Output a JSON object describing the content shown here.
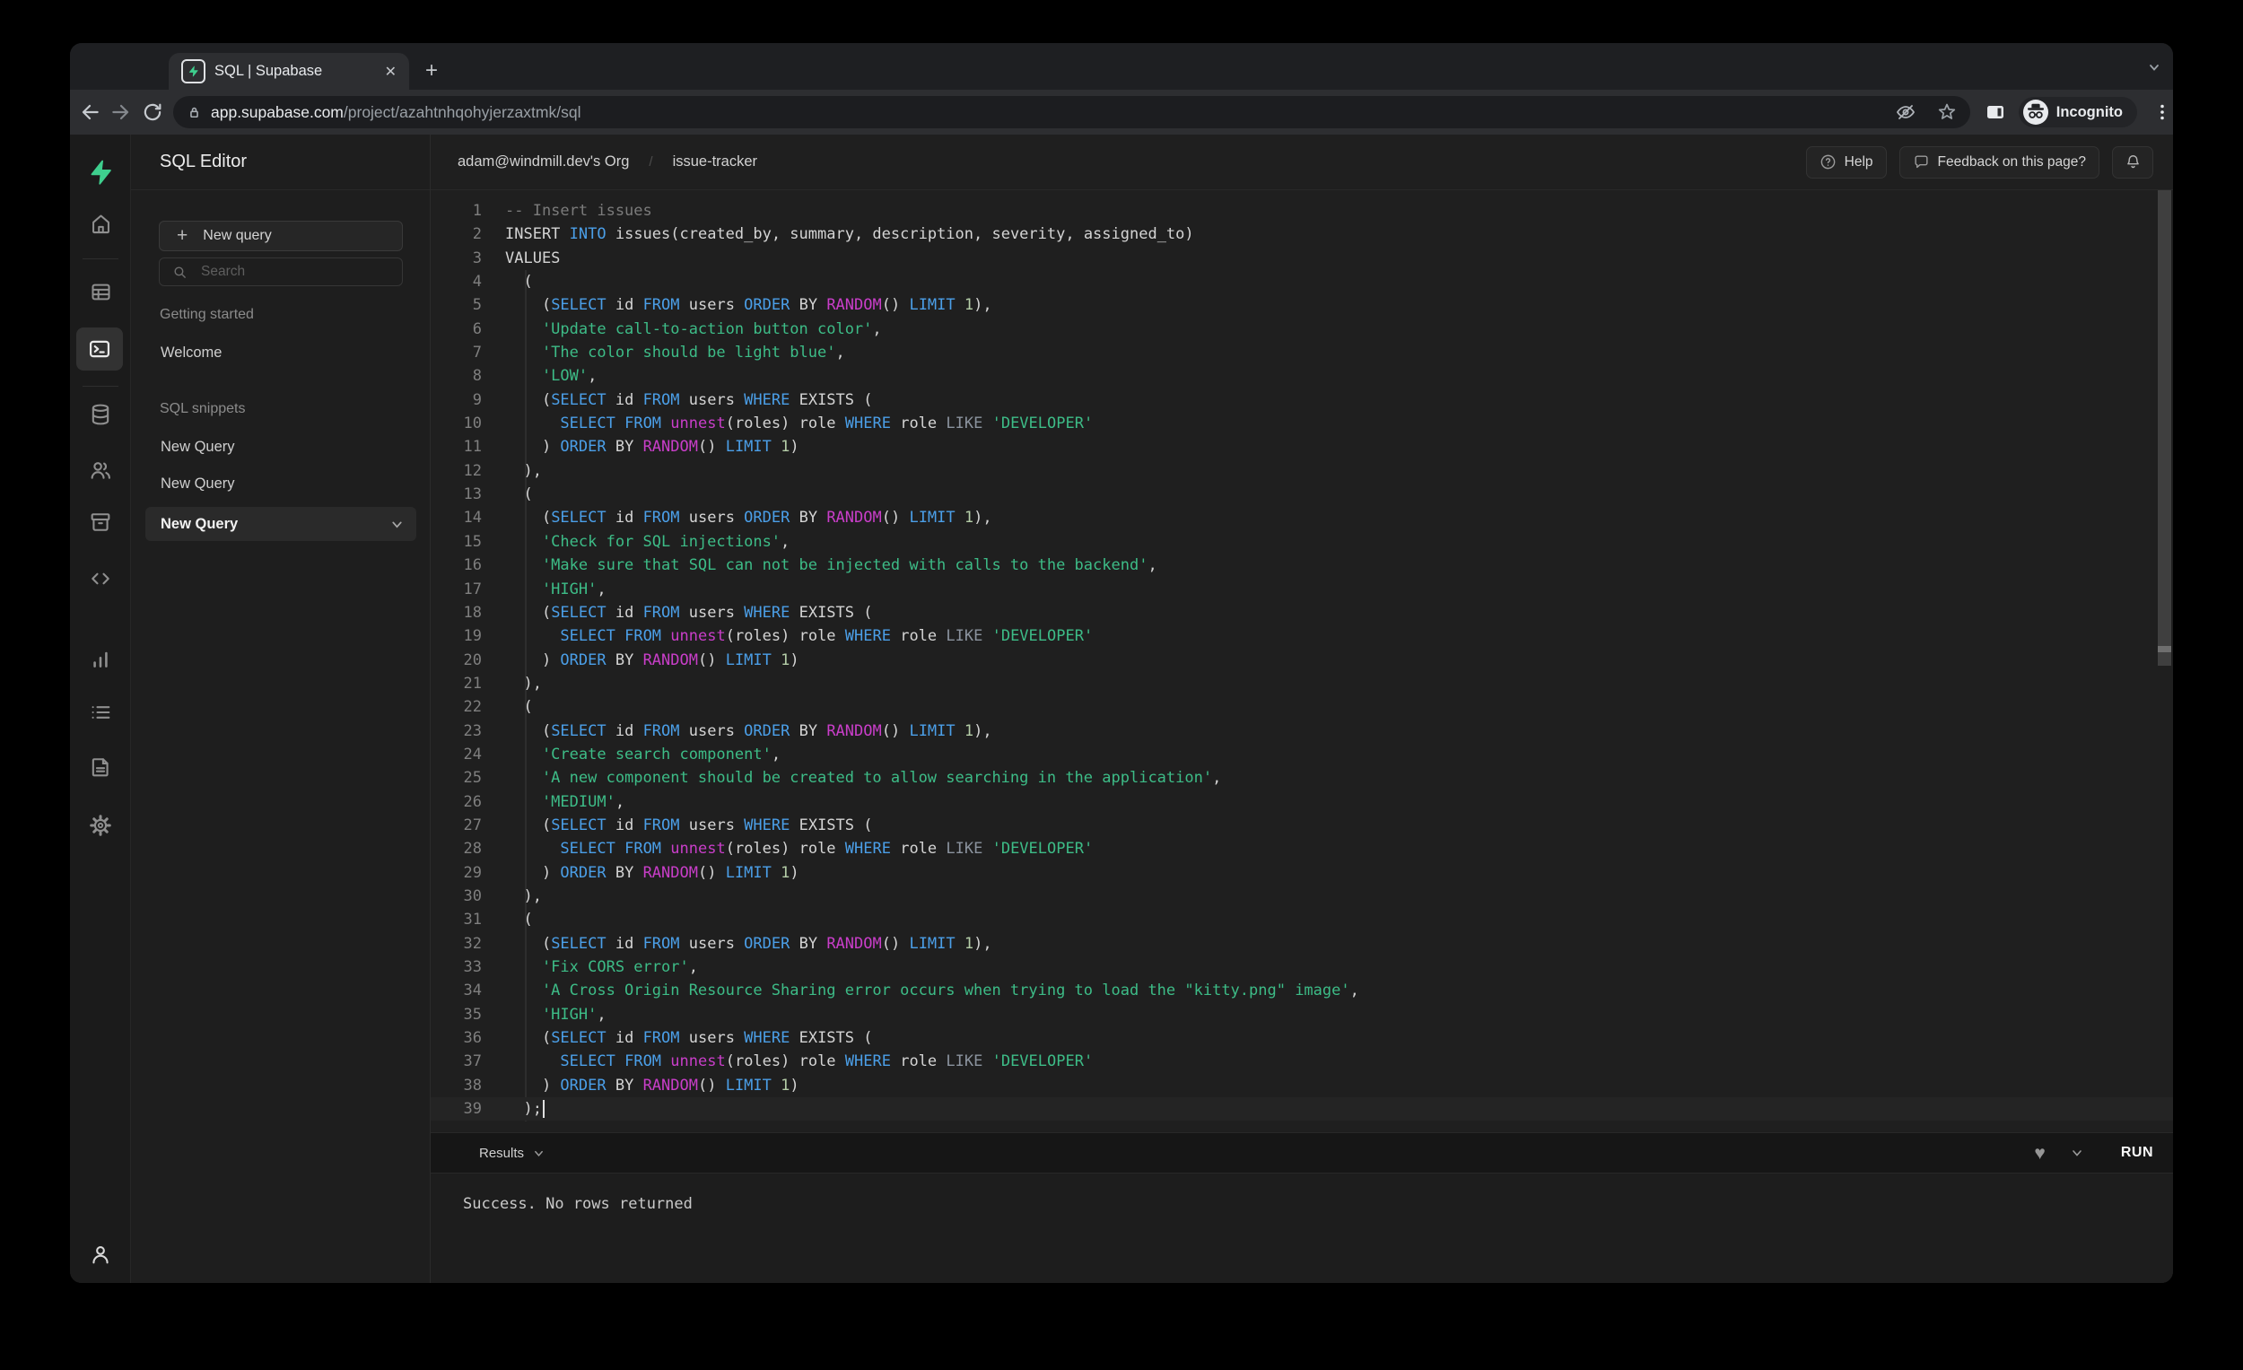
{
  "browser": {
    "tab_title": "SQL | Supabase",
    "url_host": "app.supabase.com",
    "url_path": "/project/azahtnhqohyjerzaxtmk/sql",
    "incognito_label": "Incognito"
  },
  "rail_icons": [
    "home",
    "table-editor",
    "sql-editor",
    "database",
    "auth",
    "storage",
    "api",
    "reports",
    "logs",
    "docs",
    "settings",
    "account"
  ],
  "panel": {
    "title": "SQL Editor",
    "new_query_label": "New query",
    "search_placeholder": "Search",
    "getting_started_label": "Getting started",
    "getting_started_items": [
      "Welcome"
    ],
    "snippets_label": "SQL snippets",
    "snippets": [
      "New Query",
      "New Query",
      "New Query"
    ],
    "selected_index": 2
  },
  "header": {
    "org": "adam@windmill.dev's Org",
    "separator": "/",
    "project": "issue-tracker",
    "help_label": "Help",
    "feedback_label": "Feedback on this page?"
  },
  "editor": {
    "language": "sql",
    "cursor_line": 39,
    "lines": [
      [
        [
          "c",
          "-- Insert issues"
        ]
      ],
      [
        [
          "w",
          "INSERT "
        ],
        [
          "b",
          "INTO"
        ],
        [
          "w",
          " issues(created_by, summary, description, severity, assigned_to)"
        ]
      ],
      [
        [
          "w",
          "VALUES"
        ]
      ],
      [
        [
          "w",
          "  ("
        ]
      ],
      [
        [
          "w",
          "    ("
        ],
        [
          "b",
          "SELECT"
        ],
        [
          "w",
          " id "
        ],
        [
          "b",
          "FROM"
        ],
        [
          "w",
          " users "
        ],
        [
          "b",
          "ORDER"
        ],
        [
          "w",
          " BY "
        ],
        [
          "m",
          "RANDOM"
        ],
        [
          "w",
          "() "
        ],
        [
          "b",
          "LIMIT"
        ],
        [
          "n",
          " 1"
        ],
        [
          "w",
          "),"
        ]
      ],
      [
        [
          "g",
          "    'Update call-to-action button color'"
        ],
        [
          "w",
          ","
        ]
      ],
      [
        [
          "g",
          "    'The color should be light blue'"
        ],
        [
          "w",
          ","
        ]
      ],
      [
        [
          "g",
          "    'LOW'"
        ],
        [
          "w",
          ","
        ]
      ],
      [
        [
          "w",
          "    ("
        ],
        [
          "b",
          "SELECT"
        ],
        [
          "w",
          " id "
        ],
        [
          "b",
          "FROM"
        ],
        [
          "w",
          " users "
        ],
        [
          "b",
          "WHERE"
        ],
        [
          "w",
          " EXISTS ("
        ]
      ],
      [
        [
          "w",
          "      "
        ],
        [
          "b",
          "SELECT"
        ],
        [
          "w",
          " "
        ],
        [
          "b",
          "FROM"
        ],
        [
          "w",
          " "
        ],
        [
          "m",
          "unnest"
        ],
        [
          "w",
          "(roles) role "
        ],
        [
          "b",
          "WHERE"
        ],
        [
          "w",
          " role "
        ],
        [
          "o",
          "LIKE"
        ],
        [
          "w",
          " "
        ],
        [
          "g",
          "'DEVELOPER'"
        ]
      ],
      [
        [
          "w",
          "    ) "
        ],
        [
          "b",
          "ORDER"
        ],
        [
          "w",
          " BY "
        ],
        [
          "m",
          "RANDOM"
        ],
        [
          "w",
          "() "
        ],
        [
          "b",
          "LIMIT"
        ],
        [
          "n",
          " 1"
        ],
        [
          "w",
          ")"
        ]
      ],
      [
        [
          "w",
          "  ),"
        ]
      ],
      [
        [
          "w",
          "  ("
        ]
      ],
      [
        [
          "w",
          "    ("
        ],
        [
          "b",
          "SELECT"
        ],
        [
          "w",
          " id "
        ],
        [
          "b",
          "FROM"
        ],
        [
          "w",
          " users "
        ],
        [
          "b",
          "ORDER"
        ],
        [
          "w",
          " BY "
        ],
        [
          "m",
          "RANDOM"
        ],
        [
          "w",
          "() "
        ],
        [
          "b",
          "LIMIT"
        ],
        [
          "n",
          " 1"
        ],
        [
          "w",
          "),"
        ]
      ],
      [
        [
          "g",
          "    'Check for SQL injections'"
        ],
        [
          "w",
          ","
        ]
      ],
      [
        [
          "g",
          "    'Make sure that SQL can not be injected with calls to the backend'"
        ],
        [
          "w",
          ","
        ]
      ],
      [
        [
          "g",
          "    'HIGH'"
        ],
        [
          "w",
          ","
        ]
      ],
      [
        [
          "w",
          "    ("
        ],
        [
          "b",
          "SELECT"
        ],
        [
          "w",
          " id "
        ],
        [
          "b",
          "FROM"
        ],
        [
          "w",
          " users "
        ],
        [
          "b",
          "WHERE"
        ],
        [
          "w",
          " EXISTS ("
        ]
      ],
      [
        [
          "w",
          "      "
        ],
        [
          "b",
          "SELECT"
        ],
        [
          "w",
          " "
        ],
        [
          "b",
          "FROM"
        ],
        [
          "w",
          " "
        ],
        [
          "m",
          "unnest"
        ],
        [
          "w",
          "(roles) role "
        ],
        [
          "b",
          "WHERE"
        ],
        [
          "w",
          " role "
        ],
        [
          "o",
          "LIKE"
        ],
        [
          "w",
          " "
        ],
        [
          "g",
          "'DEVELOPER'"
        ]
      ],
      [
        [
          "w",
          "    ) "
        ],
        [
          "b",
          "ORDER"
        ],
        [
          "w",
          " BY "
        ],
        [
          "m",
          "RANDOM"
        ],
        [
          "w",
          "() "
        ],
        [
          "b",
          "LIMIT"
        ],
        [
          "n",
          " 1"
        ],
        [
          "w",
          ")"
        ]
      ],
      [
        [
          "w",
          "  ),"
        ]
      ],
      [
        [
          "w",
          "  ("
        ]
      ],
      [
        [
          "w",
          "    ("
        ],
        [
          "b",
          "SELECT"
        ],
        [
          "w",
          " id "
        ],
        [
          "b",
          "FROM"
        ],
        [
          "w",
          " users "
        ],
        [
          "b",
          "ORDER"
        ],
        [
          "w",
          " BY "
        ],
        [
          "m",
          "RANDOM"
        ],
        [
          "w",
          "() "
        ],
        [
          "b",
          "LIMIT"
        ],
        [
          "n",
          " 1"
        ],
        [
          "w",
          "),"
        ]
      ],
      [
        [
          "g",
          "    'Create search component'"
        ],
        [
          "w",
          ","
        ]
      ],
      [
        [
          "g",
          "    'A new component should be created to allow searching in the application'"
        ],
        [
          "w",
          ","
        ]
      ],
      [
        [
          "g",
          "    'MEDIUM'"
        ],
        [
          "w",
          ","
        ]
      ],
      [
        [
          "w",
          "    ("
        ],
        [
          "b",
          "SELECT"
        ],
        [
          "w",
          " id "
        ],
        [
          "b",
          "FROM"
        ],
        [
          "w",
          " users "
        ],
        [
          "b",
          "WHERE"
        ],
        [
          "w",
          " EXISTS ("
        ]
      ],
      [
        [
          "w",
          "      "
        ],
        [
          "b",
          "SELECT"
        ],
        [
          "w",
          " "
        ],
        [
          "b",
          "FROM"
        ],
        [
          "w",
          " "
        ],
        [
          "m",
          "unnest"
        ],
        [
          "w",
          "(roles) role "
        ],
        [
          "b",
          "WHERE"
        ],
        [
          "w",
          " role "
        ],
        [
          "o",
          "LIKE"
        ],
        [
          "w",
          " "
        ],
        [
          "g",
          "'DEVELOPER'"
        ]
      ],
      [
        [
          "w",
          "    ) "
        ],
        [
          "b",
          "ORDER"
        ],
        [
          "w",
          " BY "
        ],
        [
          "m",
          "RANDOM"
        ],
        [
          "w",
          "() "
        ],
        [
          "b",
          "LIMIT"
        ],
        [
          "n",
          " 1"
        ],
        [
          "w",
          ")"
        ]
      ],
      [
        [
          "w",
          "  ),"
        ]
      ],
      [
        [
          "w",
          "  ("
        ]
      ],
      [
        [
          "w",
          "    ("
        ],
        [
          "b",
          "SELECT"
        ],
        [
          "w",
          " id "
        ],
        [
          "b",
          "FROM"
        ],
        [
          "w",
          " users "
        ],
        [
          "b",
          "ORDER"
        ],
        [
          "w",
          " BY "
        ],
        [
          "m",
          "RANDOM"
        ],
        [
          "w",
          "() "
        ],
        [
          "b",
          "LIMIT"
        ],
        [
          "n",
          " 1"
        ],
        [
          "w",
          "),"
        ]
      ],
      [
        [
          "g",
          "    'Fix CORS error'"
        ],
        [
          "w",
          ","
        ]
      ],
      [
        [
          "g",
          "    'A Cross Origin Resource Sharing error occurs when trying to load the \"kitty.png\" image'"
        ],
        [
          "w",
          ","
        ]
      ],
      [
        [
          "g",
          "    'HIGH'"
        ],
        [
          "w",
          ","
        ]
      ],
      [
        [
          "w",
          "    ("
        ],
        [
          "b",
          "SELECT"
        ],
        [
          "w",
          " id "
        ],
        [
          "b",
          "FROM"
        ],
        [
          "w",
          " users "
        ],
        [
          "b",
          "WHERE"
        ],
        [
          "w",
          " EXISTS ("
        ]
      ],
      [
        [
          "w",
          "      "
        ],
        [
          "b",
          "SELECT"
        ],
        [
          "w",
          " "
        ],
        [
          "b",
          "FROM"
        ],
        [
          "w",
          " "
        ],
        [
          "m",
          "unnest"
        ],
        [
          "w",
          "(roles) role "
        ],
        [
          "b",
          "WHERE"
        ],
        [
          "w",
          " role "
        ],
        [
          "o",
          "LIKE"
        ],
        [
          "w",
          " "
        ],
        [
          "g",
          "'DEVELOPER'"
        ]
      ],
      [
        [
          "w",
          "    ) "
        ],
        [
          "b",
          "ORDER"
        ],
        [
          "w",
          " BY "
        ],
        [
          "m",
          "RANDOM"
        ],
        [
          "w",
          "() "
        ],
        [
          "b",
          "LIMIT"
        ],
        [
          "n",
          " 1"
        ],
        [
          "w",
          ")"
        ]
      ],
      [
        [
          "w",
          "  );"
        ]
      ]
    ]
  },
  "results": {
    "label": "Results",
    "run_label": "RUN",
    "message": "Success. No rows returned"
  },
  "colors": {
    "accent_green": "#3ecf8e",
    "keyword_blue": "#4b9fe8",
    "function_magenta": "#c93ec9",
    "string_green": "#3dbc87",
    "number_green": "#b5cea8",
    "comment_gray": "#7b7b7b",
    "operator_gray": "#8b939e"
  }
}
